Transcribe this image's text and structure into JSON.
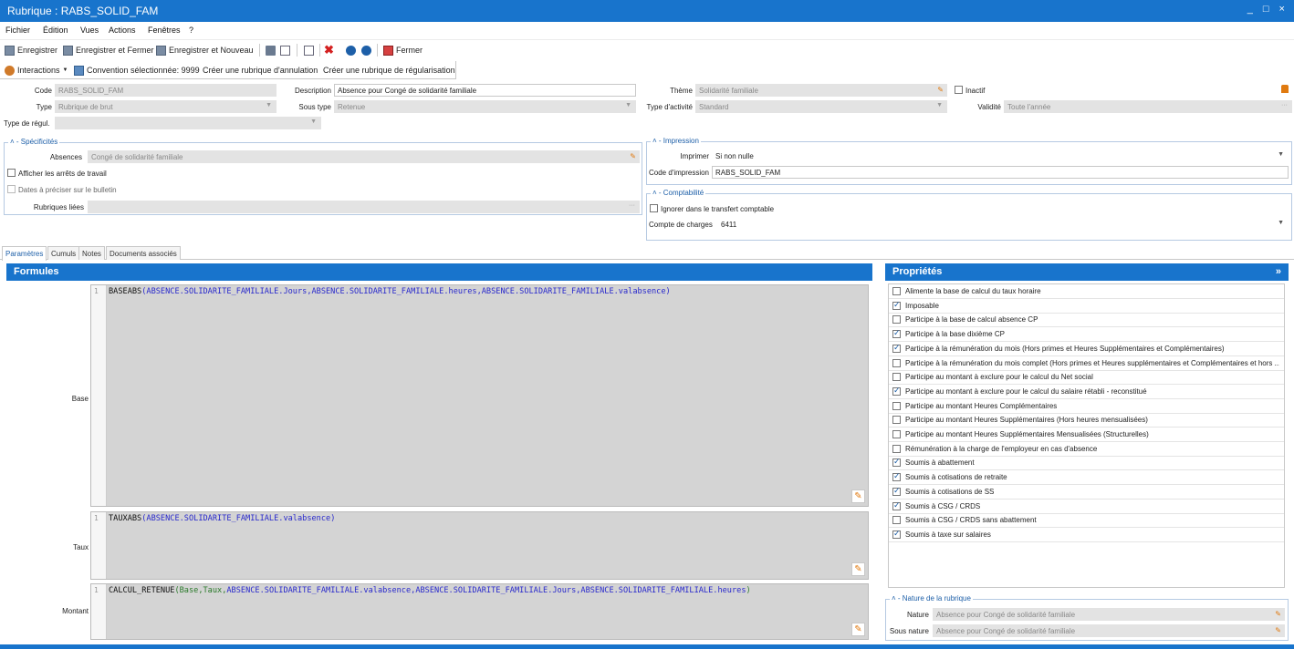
{
  "window": {
    "title": "Rubrique : RABS_SOLID_FAM",
    "controls": "_ □ ×"
  },
  "menu": [
    "Fichier",
    "Édition",
    "Vues",
    "Actions",
    "Fenêtres",
    "?"
  ],
  "toolbar": {
    "save": "Enregistrer",
    "save_close": "Enregistrer et Fermer",
    "save_new": "Enregistrer et Nouveau",
    "close": "Fermer"
  },
  "toolbar2": {
    "interactions": "Interactions",
    "convention": "Convention sélectionnée: 9999",
    "create_cancel": "Créer une rubrique d'annulation",
    "create_regul": "Créer une rubrique de régularisation"
  },
  "form": {
    "code_label": "Code",
    "code_value": "RABS_SOLID_FAM",
    "description_label": "Description",
    "description_value": "Absence pour Congé de solidarité familiale",
    "theme_label": "Thème",
    "theme_value": "Solidarité familiale",
    "inactif_label": "Inactif",
    "type_label": "Type",
    "type_value": "Rubrique de brut",
    "soustype_label": "Sous type",
    "soustype_value": "Retenue",
    "typeactivite_label": "Type d'activité",
    "typeactivite_value": "Standard",
    "validite_label": "Validité",
    "validite_value": "Toute l'année",
    "typeregul_label": "Type de régul.",
    "typeregul_value": ""
  },
  "specificites": {
    "title": "Spécificités",
    "absences_label": "Absences",
    "absences_value": "Congé de solidarité familiale",
    "afficher_arrets": "Afficher les arrêts de travail",
    "dates_preciser": "Dates à préciser sur le bulletin",
    "rubriques_liees_label": "Rubriques liées",
    "rubriques_liees_value": ""
  },
  "impression": {
    "title": "Impression",
    "imprimer_label": "Imprimer",
    "imprimer_value": "Si non nulle",
    "code_label": "Code d'impression",
    "code_value": "RABS_SOLID_FAM"
  },
  "comptabilite": {
    "title": "Comptabilité",
    "ignorer": "Ignorer dans le transfert comptable",
    "compte_label": "Compte de charges",
    "compte_value": "6411"
  },
  "tabs": [
    "Paramètres",
    "Cumuls",
    "Notes",
    "Documents associés"
  ],
  "formules": {
    "title": "Formules",
    "base_label": "Base",
    "taux_label": "Taux",
    "montant_label": "Montant",
    "line_no": "1",
    "base": {
      "fn": "BASEABS",
      "open": "(",
      "args": "ABSENCE.SOLIDARITE_FAMILIALE.Jours,ABSENCE.SOLIDARITE_FAMILIALE.heures,ABSENCE.SOLIDARITE_FAMILIALE.valabsence",
      "close": ")"
    },
    "taux": {
      "fn": "TAUXABS",
      "open": "(",
      "args": "ABSENCE.SOLIDARITE_FAMILIALE.valabsence",
      "close": ")"
    },
    "montant": {
      "fn": "CALCUL_RETENUE",
      "open": "(",
      "vars": "Base,Taux,",
      "args": "ABSENCE.SOLIDARITE_FAMILIALE.valabsence,ABSENCE.SOLIDARITE_FAMILIALE.Jours,ABSENCE.SOLIDARITE_FAMILIALE.heures",
      "close": ")"
    }
  },
  "proprietes": {
    "title": "Propriétés",
    "collapse": "»",
    "items": [
      {
        "label": "Alimente la base de calcul du taux horaire",
        "checked": false
      },
      {
        "label": "Imposable",
        "checked": true
      },
      {
        "label": "Participe à la base de calcul absence CP",
        "checked": false
      },
      {
        "label": "Participe à la base dixième CP",
        "checked": true
      },
      {
        "label": "Participe à la rémunération du mois (Hors primes et Heures Supplémentaires et Complémentaires)",
        "checked": true
      },
      {
        "label": "Participe à la rémunération du mois complet (Hors primes et Heures supplémentaires et Complémentaires et hors ...",
        "checked": false
      },
      {
        "label": "Participe au montant à exclure pour le calcul du Net social",
        "checked": false
      },
      {
        "label": "Participe au montant à exclure pour le calcul du salaire rétabli - reconstitué",
        "checked": true
      },
      {
        "label": "Participe au montant Heures Complémentaires",
        "checked": false
      },
      {
        "label": "Participe au montant Heures Supplémentaires (Hors heures mensualisées)",
        "checked": false
      },
      {
        "label": "Participe au montant Heures Supplémentaires Mensualisées (Structurelles)",
        "checked": false
      },
      {
        "label": "Rémunération à la charge de l'employeur en cas d'absence",
        "checked": false
      },
      {
        "label": "Soumis à abattement",
        "checked": true
      },
      {
        "label": "Soumis à cotisations de retraite",
        "checked": true
      },
      {
        "label": "Soumis à cotisations de SS",
        "checked": true
      },
      {
        "label": "Soumis à CSG / CRDS",
        "checked": true
      },
      {
        "label": "Soumis à CSG / CRDS sans abattement",
        "checked": false
      },
      {
        "label": "Soumis à taxe sur salaires",
        "checked": true
      }
    ]
  },
  "nature": {
    "title": "Nature de la rubrique",
    "nature_label": "Nature",
    "nature_value": "Absence pour Congé de solidarité familiale",
    "sousnature_label": "Sous nature",
    "sousnature_value": "Absence pour Congé de solidarité familiale"
  }
}
